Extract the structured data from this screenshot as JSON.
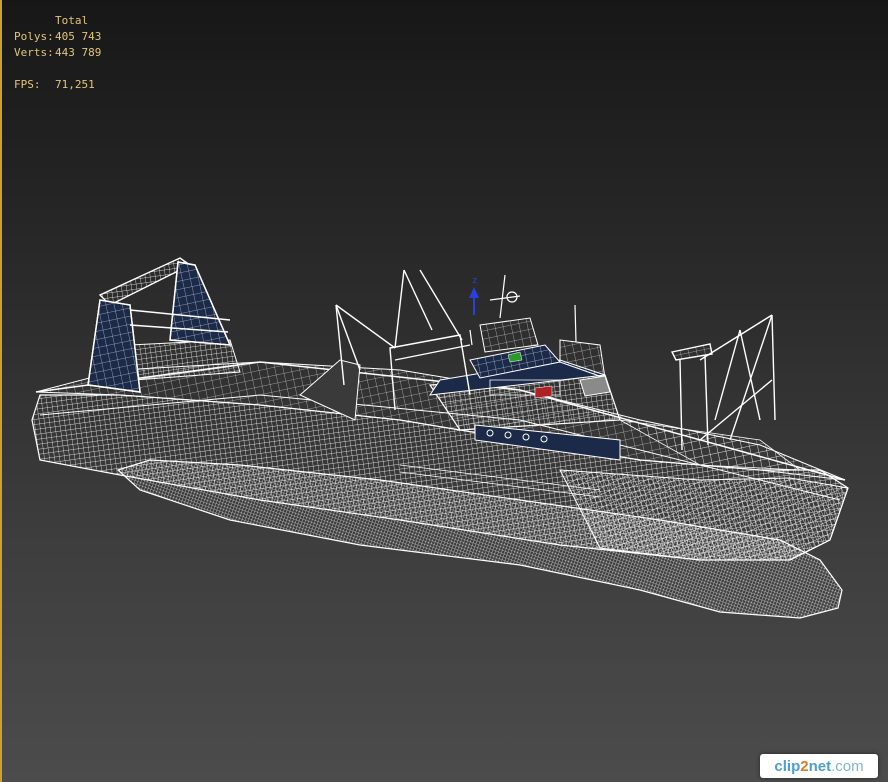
{
  "viewport": {
    "stats": {
      "header": "Total",
      "polys_label": "Polys:",
      "polys_value": "405 743",
      "verts_label": "Verts:",
      "verts_value": "443 789",
      "fps_label": "FPS:",
      "fps_value": "71,251"
    },
    "gizmo_axis_label": "z"
  },
  "watermark": {
    "part1": "clip",
    "part2": "2",
    "part3": "net",
    "part4": ".com"
  },
  "colors": {
    "stats_text": "#e2c57a",
    "viewport_border": "#c9a32b",
    "wireframe": "#ffffff",
    "hull_band": "#1c2a4a",
    "gizmo_z": "#2a3fe0"
  },
  "icons": [
    "ship-wireframe-model",
    "transform-gizmo-icon"
  ]
}
